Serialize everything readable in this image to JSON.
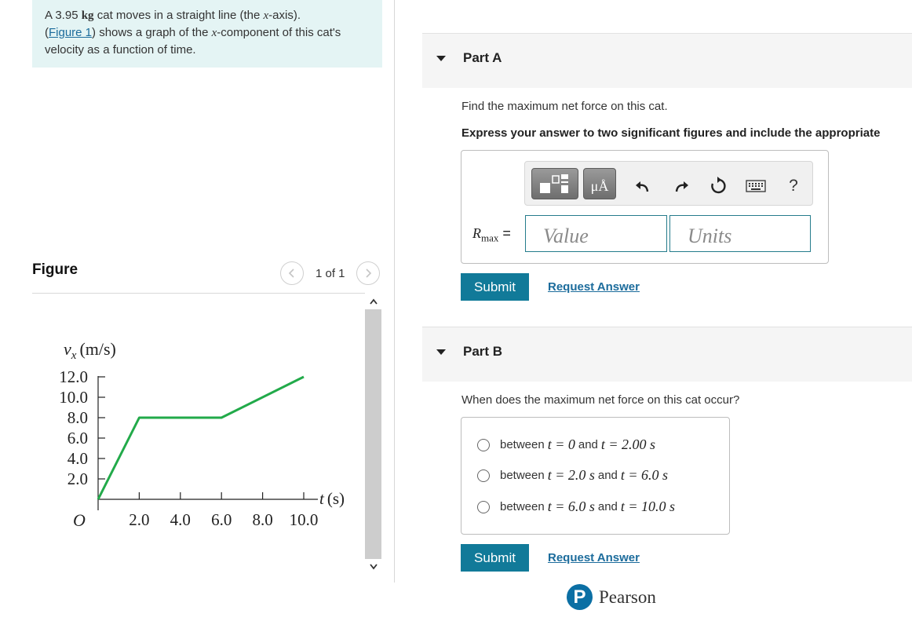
{
  "intro": {
    "t1": "A 3.95 ",
    "unit": "kg",
    "t2": " cat moves in a straight line (the ",
    "axis_var": "x",
    "t3": "-axis).",
    "paren_open": "(",
    "figure_link": "Figure 1",
    "t4": ") shows a graph of the ",
    "comp_var": "x",
    "t5": "-component of this cat's velocity as a function of time."
  },
  "figure": {
    "label": "Figure",
    "pager_text": "1 of 1"
  },
  "chart_data": {
    "type": "line",
    "ylabel": "v",
    "ylabel_sub": "x",
    "ylabel_unit": "(m/s)",
    "xlabel": "t",
    "xlabel_unit": "(s)",
    "origin_label": "O",
    "y_ticks": [
      "12.0",
      "10.0",
      "8.0",
      "6.0",
      "4.0",
      "2.0"
    ],
    "x_ticks": [
      "2.0",
      "4.0",
      "6.0",
      "8.0",
      "10.0"
    ],
    "xlim": [
      0,
      10
    ],
    "ylim": [
      0,
      12
    ],
    "x": [
      0,
      2,
      6,
      10
    ],
    "y": [
      0,
      8,
      8,
      12
    ],
    "line_color": "#22aa4a"
  },
  "partA": {
    "title": "Part A",
    "question": "Find the maximum net force on this cat.",
    "instruction": "Express your answer to two significant figures and include the appropriate",
    "var_main": "R",
    "var_sub": "max",
    "equals": " =",
    "value_placeholder": "Value",
    "units_placeholder": "Units",
    "submit_label": "Submit",
    "request_label": "Request Answer",
    "toolbar": {
      "units_btn_label": "μÅ",
      "help_label": "?",
      "icons": [
        "templates-icon",
        "units-icon",
        "undo-icon",
        "redo-icon",
        "reset-icon",
        "keyboard-icon",
        "help-icon"
      ]
    }
  },
  "partB": {
    "title": "Part B",
    "question": "When does the maximum net force on this cat occur?",
    "between": "between",
    "and": "and",
    "options": [
      {
        "a": "t = 0",
        "b": "t = 2.00 s"
      },
      {
        "a": "t = 2.0 s",
        "b": "t = 6.0 s"
      },
      {
        "a": "t = 6.0 s",
        "b": "t = 10.0 s"
      }
    ],
    "submit_label": "Submit",
    "request_label": "Request Answer"
  },
  "footer": {
    "logo_letter": "P",
    "brand": "Pearson",
    "brand_color": "#0b6fa4"
  },
  "colors": {
    "accent": "#117a99",
    "intro_bg": "#e4f4f4",
    "link": "#1c6c9c"
  }
}
